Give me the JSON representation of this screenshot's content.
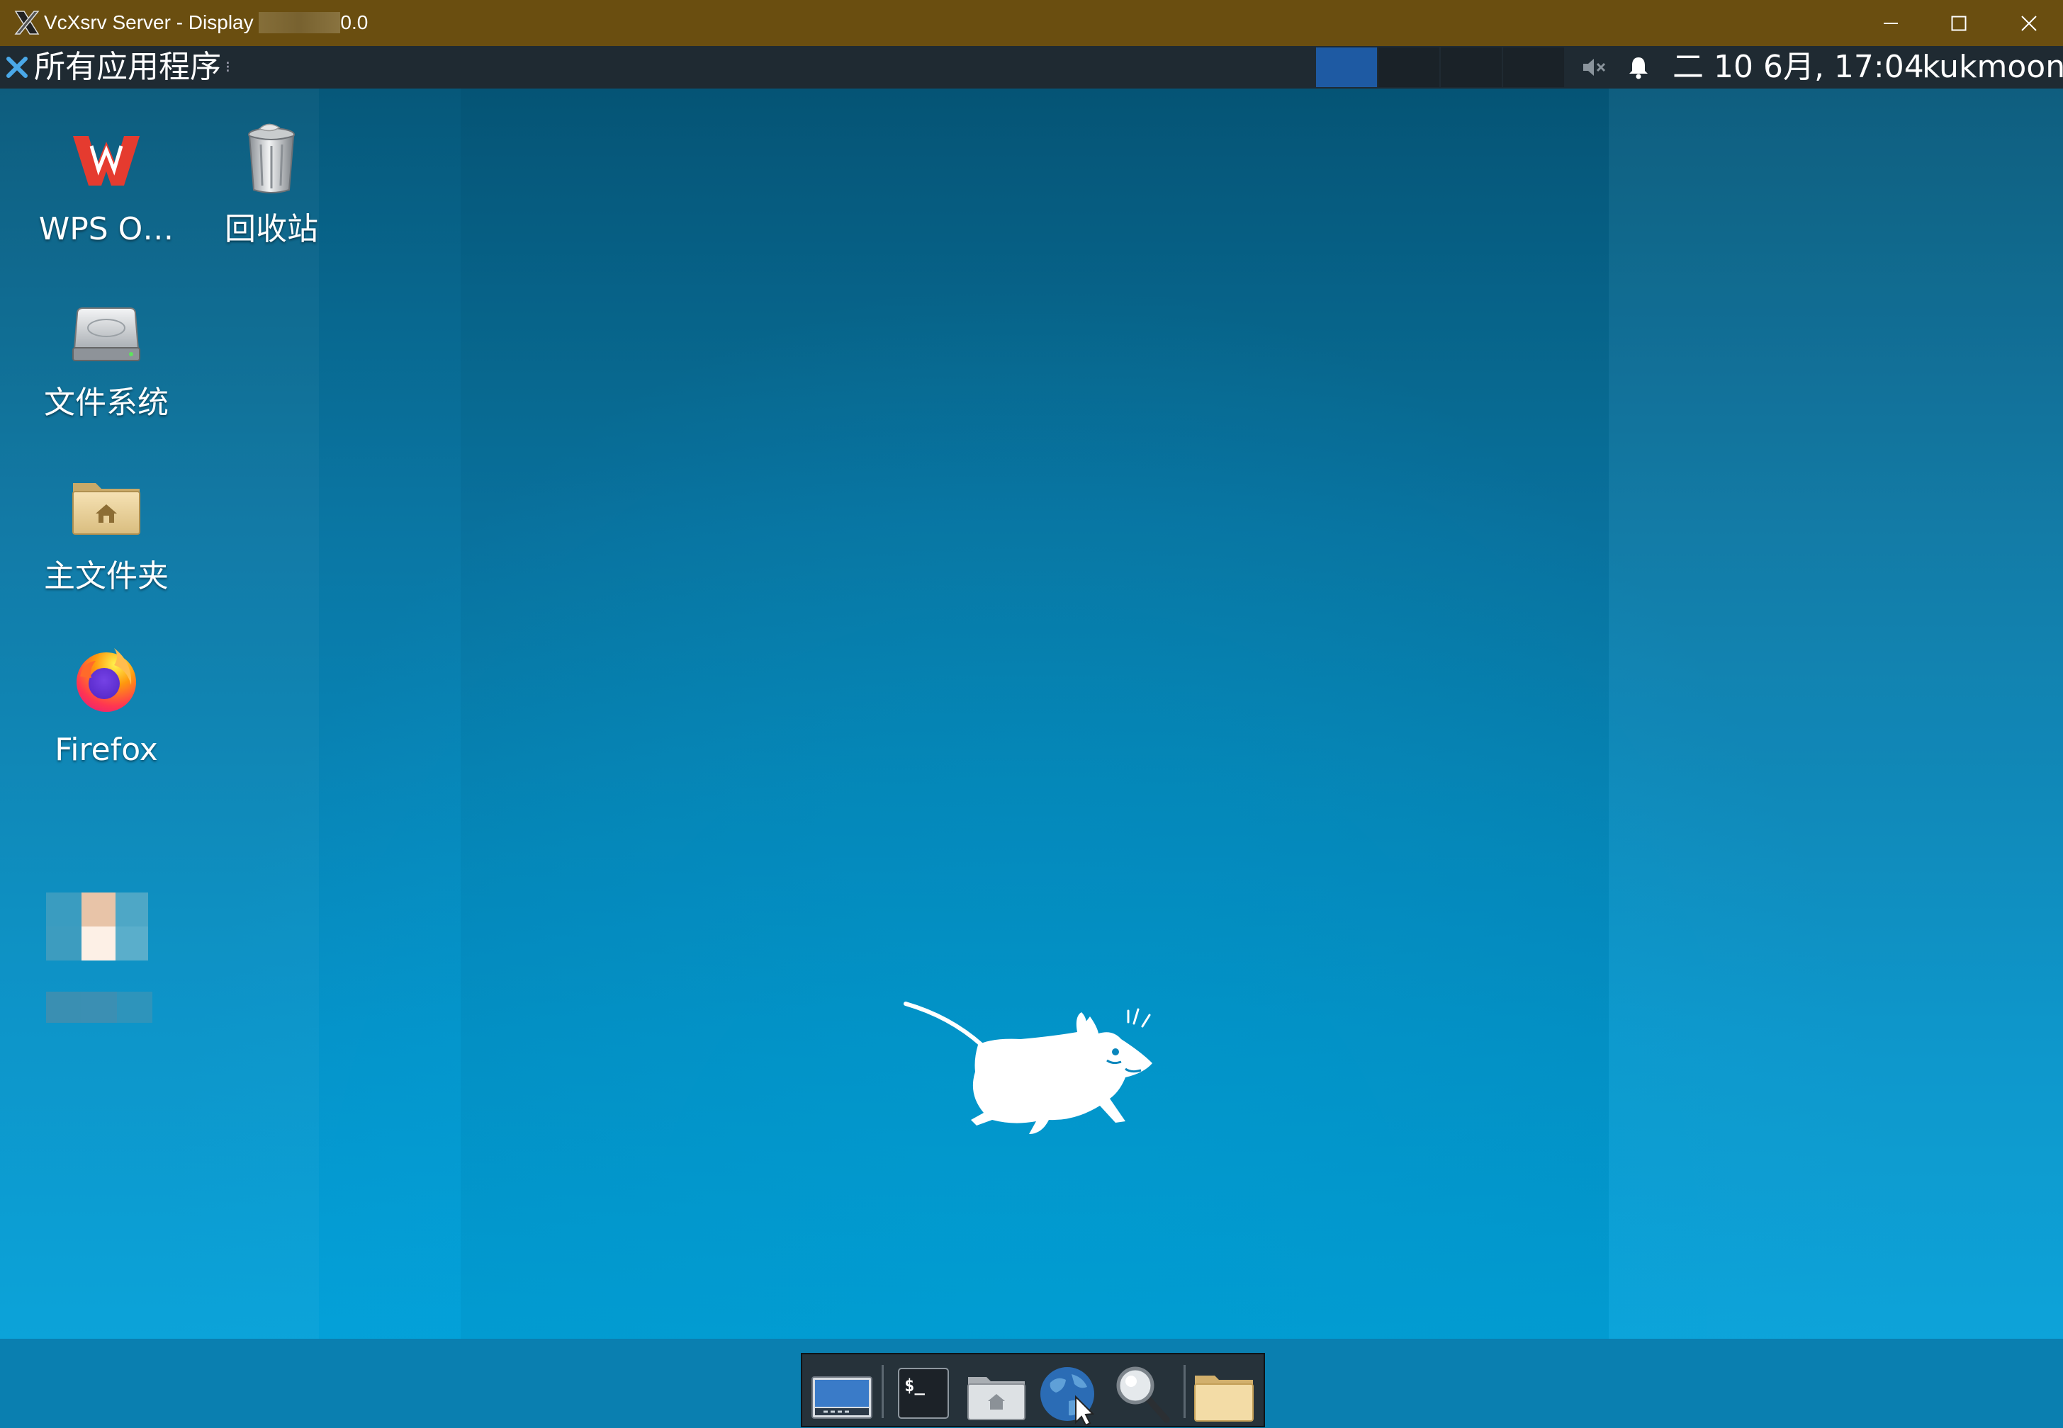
{
  "window": {
    "app_title": "VcXsrv Server - Display",
    "display_suffix": "0.0",
    "controls": [
      "minimize-icon",
      "maximize-icon",
      "close-icon"
    ]
  },
  "panel": {
    "menu_label": "所有应用程序",
    "menu_handle": "⁝",
    "workspaces": [
      {
        "name": "workspace-1",
        "active": true
      },
      {
        "name": "workspace-2",
        "active": false
      },
      {
        "name": "workspace-3",
        "active": false
      },
      {
        "name": "workspace-4",
        "active": false
      }
    ],
    "tray": [
      "volume-muted-icon",
      "notification-bell-icon"
    ],
    "clock": "二 10 6月, 17:04",
    "user": "kukmoon"
  },
  "desktop": {
    "icons": [
      {
        "label": "WPS O…",
        "icon": "wps-office-icon"
      },
      {
        "label": "回收站",
        "icon": "trash-icon"
      },
      {
        "label": "文件系统",
        "icon": "hard-drive-icon"
      },
      {
        "label": "主文件夹",
        "icon": "home-folder-icon"
      },
      {
        "label": "Firefox",
        "icon": "firefox-icon"
      }
    ],
    "wallpaper": "xfce-mouse-logo"
  },
  "dock": {
    "items": [
      "show-desktop-icon",
      "terminal-icon",
      "home-folder-icon",
      "web-browser-icon",
      "app-finder-icon",
      "folder-icon"
    ],
    "terminal_glyph": "$_"
  },
  "colors": {
    "titlebar": "#6a4e10",
    "panel": "#1f2a32",
    "active_workspace": "#1e5aa3",
    "desktop_top": "#06587a",
    "desktop_bottom": "#04a0d8"
  }
}
